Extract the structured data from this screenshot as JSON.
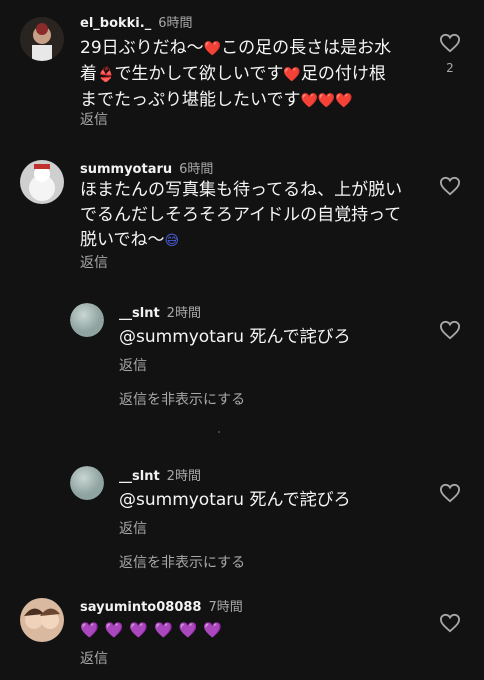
{
  "comments": [
    {
      "user": "el_bokki._",
      "time": "6時間",
      "line1": "29日ぶりだね〜",
      "line1b": "この足の長さは是お水",
      "line2a": "着",
      "line2b": "で生かして欲しいです",
      "line2c": "足の付け根",
      "line3": "までたっぷり堪能したいです",
      "reply": "返信",
      "likes": "2"
    },
    {
      "user": "summyotaru",
      "time": "6時間",
      "line1": "ほまたんの写真集も待ってるね、上が脱い",
      "line2": "でるんだしそろそろアイドルの自覚持って",
      "line3": "脱いでね〜",
      "reply": "返信"
    },
    {
      "user": "__slnt",
      "time": "2時間",
      "text": "@summyotaru 死んで詫びろ",
      "reply": "返信",
      "hide": "返信を非表示にする"
    },
    {
      "user": "__slnt",
      "time": "2時間",
      "text": "@summyotaru 死んで詫びろ",
      "reply": "返信",
      "hide": "返信を非表示にする"
    },
    {
      "user": "sayuminto08088",
      "time": "7時間",
      "emojis": "💜💜💜💜💜💜",
      "reply": "返信"
    }
  ],
  "colors": {
    "background": "#121212",
    "secondary_text": "#a8a8a8",
    "heart_emoji": "#e0263c",
    "purple_heart": "#b452d6"
  },
  "icons": {
    "like": "heart-outline-icon",
    "inline_heart": "red-heart-emoji",
    "bikini": "bikini-emoji",
    "sweat": "sweat-emoji",
    "purple_heart": "purple-heart-emoji"
  }
}
